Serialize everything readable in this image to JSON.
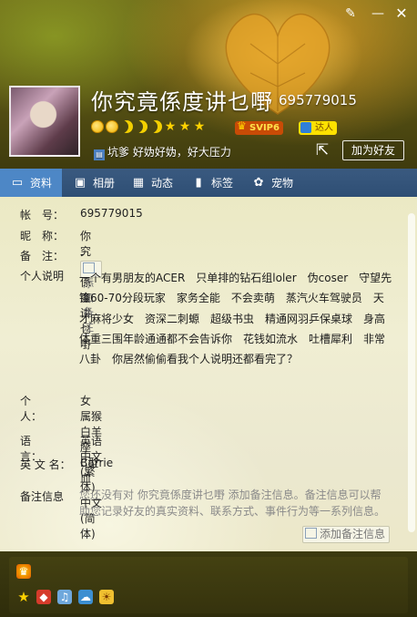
{
  "header": {
    "nickname": "你究竟係度讲乜嘢",
    "qq": "695779015",
    "svip": "SVIP6",
    "daren": "达人",
    "signature_prefix": "坑爹",
    "signature": "好妫好妫，好大压力",
    "add_friend": "加为好友"
  },
  "tabs": [
    {
      "label": "资料",
      "icon": "profile-card-icon"
    },
    {
      "label": "相册",
      "icon": "photo-album-icon"
    },
    {
      "label": "动态",
      "icon": "feed-grid-icon"
    },
    {
      "label": "标签",
      "icon": "bookmark-tag-icon"
    },
    {
      "label": "宠物",
      "icon": "paw-pet-icon"
    }
  ],
  "profile": {
    "account_label": "帐　号：",
    "account": "695779015",
    "nickname_label": "昵　称：",
    "nickname": "你究竟係度讲乜嘢",
    "remark_label": "备　注：",
    "remark_value": "-",
    "add_remark_btn": "添加备注",
    "desc_label": "个人说明",
    "desc": "一个有男朋友的ACER　只单排的钻石组loler　伪coser　守望先锋60-70分段玩家　家务全能　不会卖萌　蒸汽火车驾驶员　天才麻将少女　资深二刺螈　超级书虫　精通网羽乒保桌球　身高体重三围年龄通通都不会告诉你　花钱如流水　吐槽犀利　非常八卦　你居然偷偷看我个人说明还都看完了？",
    "person_label": "个　　人：",
    "person": "女　属猴　白羊座　B型血",
    "lang_label": "语　　言：",
    "lang": "英语　中文(繁体)　中文(简体)",
    "en_name_label": "英 文 名：",
    "en_name": "Carrie",
    "remark_info_label": "备注信息",
    "remark_info": "您还没有对 你究竟係度讲乜嘢 添加备注信息。备注信息可以帮助您记录好友的真实资料、联系方式、事件行为等一系列信息。",
    "add_remark_info_btn": "添加备注信息"
  },
  "colors": {
    "tab_bar": "#2e4e74",
    "tab_active": "#4d87c6",
    "content_bg": "#ece9cc",
    "svip_bg": "#c84b06",
    "daren_bg": "#ffe100"
  }
}
